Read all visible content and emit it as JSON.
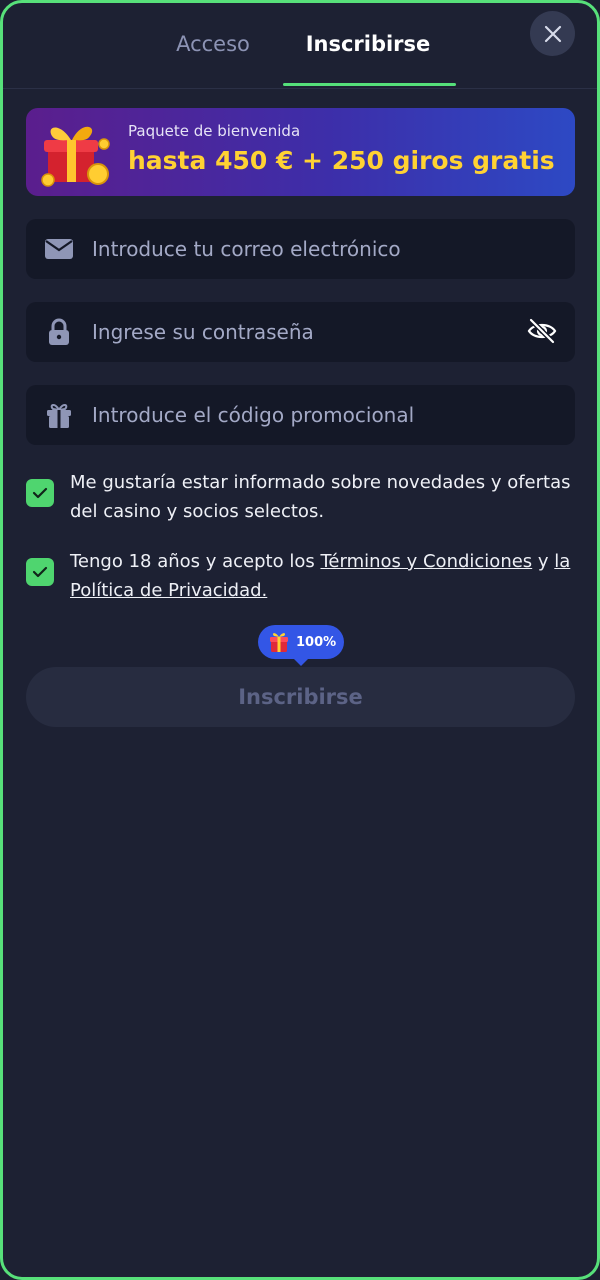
{
  "tabs": {
    "login_label": "Acceso",
    "register_label": "Inscribirse",
    "active": "register"
  },
  "banner": {
    "subtitle": "Paquete de bienvenida",
    "title": "hasta 450 € + 250 giros gratis"
  },
  "form": {
    "email_placeholder": "Introduce tu correo electrónico",
    "email_value": "",
    "password_placeholder": "Ingrese su contraseña",
    "password_value": "",
    "promo_placeholder": "Introduce el código promocional",
    "promo_value": ""
  },
  "consents": {
    "newsletter_text": "Me gustaría estar informado sobre novedades y ofertas del casino y socios selectos.",
    "newsletter_checked": true,
    "age_prefix": "Tengo 18 años y acepto los ",
    "terms_link": "Términos y Condiciones",
    "age_middle": " y ",
    "privacy_link": "la Política de Privacidad.",
    "age_checked": true
  },
  "bonus": {
    "progress_text": "100%",
    "progress": 1.0
  },
  "submit": {
    "label": "Inscribirse",
    "enabled": false
  },
  "icons": {
    "close": "close-icon",
    "email": "envelope-icon",
    "password": "lock-icon",
    "toggle_visibility": "eye-off-icon",
    "promo": "gift-icon",
    "bonus": "gift-box-icon",
    "check": "checkmark-icon"
  },
  "colors": {
    "background": "#1d2133",
    "frame_border": "#57e07a",
    "accent_green": "#55e07a",
    "banner_title": "#ffd233",
    "pill_blue": "#3356e6",
    "input_bg": "#141827",
    "button_disabled_bg": "#272c40",
    "button_disabled_text": "#5c6386"
  }
}
